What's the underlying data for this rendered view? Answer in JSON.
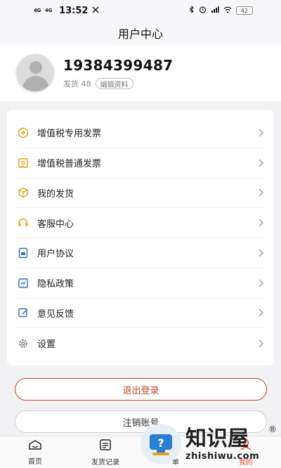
{
  "status_bar": {
    "net1": "4G",
    "net2": "4G",
    "time": "13:52",
    "battery": "42"
  },
  "header": {
    "title": "用户中心"
  },
  "profile": {
    "phone": "19384399487",
    "shipments_label": "发货 48",
    "edit_label": "编辑资料"
  },
  "menu": {
    "items": [
      {
        "label": "增值税专用发票",
        "icon": "special-invoice-icon",
        "color": "#e0a21a"
      },
      {
        "label": "增值税普通发票",
        "icon": "general-invoice-icon",
        "color": "#e0a21a"
      },
      {
        "label": "我的发货",
        "icon": "package-icon",
        "color": "#e0a21a"
      },
      {
        "label": "客服中心",
        "icon": "headset-icon",
        "color": "#e0a21a"
      },
      {
        "label": "用户协议",
        "icon": "agreement-icon",
        "color": "#2f6fb5"
      },
      {
        "label": "隐私政策",
        "icon": "privacy-icon",
        "color": "#2f6fb5"
      },
      {
        "label": "意见反馈",
        "icon": "feedback-icon",
        "color": "#2f6fb5"
      },
      {
        "label": "设置",
        "icon": "gear-icon",
        "color": "#666666"
      }
    ]
  },
  "buttons": {
    "logout": "退出登录",
    "cancel_account": "注销账号"
  },
  "tabs": [
    {
      "label": "首页",
      "icon": "home-icon",
      "active": false
    },
    {
      "label": "发货记录",
      "icon": "records-icon",
      "active": false
    },
    {
      "label": "单",
      "icon": "order-icon",
      "active": false
    },
    {
      "label": "我的",
      "icon": "user-icon",
      "active": true
    }
  ],
  "watermark": {
    "cn": "知识屋",
    "en": "zhishiwu.com",
    "reg": "®"
  },
  "colors": {
    "accent": "#c0472b",
    "active_tab": "#e04a2c"
  }
}
